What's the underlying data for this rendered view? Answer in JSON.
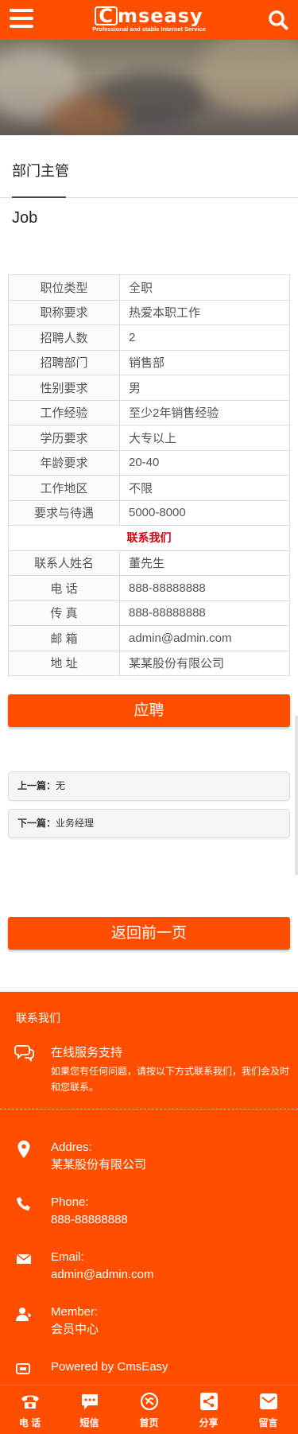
{
  "header": {
    "logo_text": "CmsEasy",
    "logo_tagline": "Professional and stable Internet Service"
  },
  "category_title": "部门主管",
  "sub_title": "Job",
  "job_table": [
    {
      "key": "职位类型",
      "value": "全职"
    },
    {
      "key": "职称要求",
      "value": "热爱本职工作"
    },
    {
      "key": "招聘人数",
      "value": "2"
    },
    {
      "key": "招聘部门",
      "value": "销售部"
    },
    {
      "key": "性别要求",
      "value": "男"
    },
    {
      "key": "工作经验",
      "value": "至少2年销售经验"
    },
    {
      "key": "学历要求",
      "value": "大专以上"
    },
    {
      "key": "年龄要求",
      "value": "20-40"
    },
    {
      "key": "工作地区",
      "value": "不限"
    },
    {
      "key": "要求与待遇",
      "value": "5000-8000"
    }
  ],
  "contact_heading": "联系我们",
  "contact_table": [
    {
      "key": "联系人姓名",
      "value": "董先生"
    },
    {
      "key": "电 话",
      "value": "888-88888888"
    },
    {
      "key": "传 真",
      "value": "888-88888888"
    },
    {
      "key": "邮 箱",
      "value": "admin@admin.com"
    },
    {
      "key": "地 址",
      "value": "某某股份有限公司"
    }
  ],
  "apply_button": "应聘",
  "pager": {
    "prev_label": "上一篇：",
    "prev_value": "无",
    "next_label": "下一篇：",
    "next_value": "业务经理"
  },
  "back_button": "返回前一页",
  "footer": {
    "heading": "联系我们",
    "support_title": "在线服务支持",
    "support_desc": "如果您有任何问题，请按以下方式联系我们，我们会及时和您联系。",
    "address_label": "Addres:",
    "address_value": "某某股份有限公司",
    "phone_label": "Phone:",
    "phone_value": "888-88888888",
    "email_label": "Email:",
    "email_value": "admin@admin.com",
    "member_label": "Member:",
    "member_value": "会员中心",
    "powered_by": "Powered by CmsEasy"
  },
  "bottom_nav": [
    {
      "label": "电 话",
      "icon": "phone-icon"
    },
    {
      "label": "短信",
      "icon": "sms-icon"
    },
    {
      "label": "首页",
      "icon": "home-icon"
    },
    {
      "label": "分享",
      "icon": "share-icon"
    },
    {
      "label": "留言",
      "icon": "mail-icon"
    }
  ],
  "colors": {
    "brand": "#ff4e00",
    "contact_heading": "#d6000f"
  }
}
